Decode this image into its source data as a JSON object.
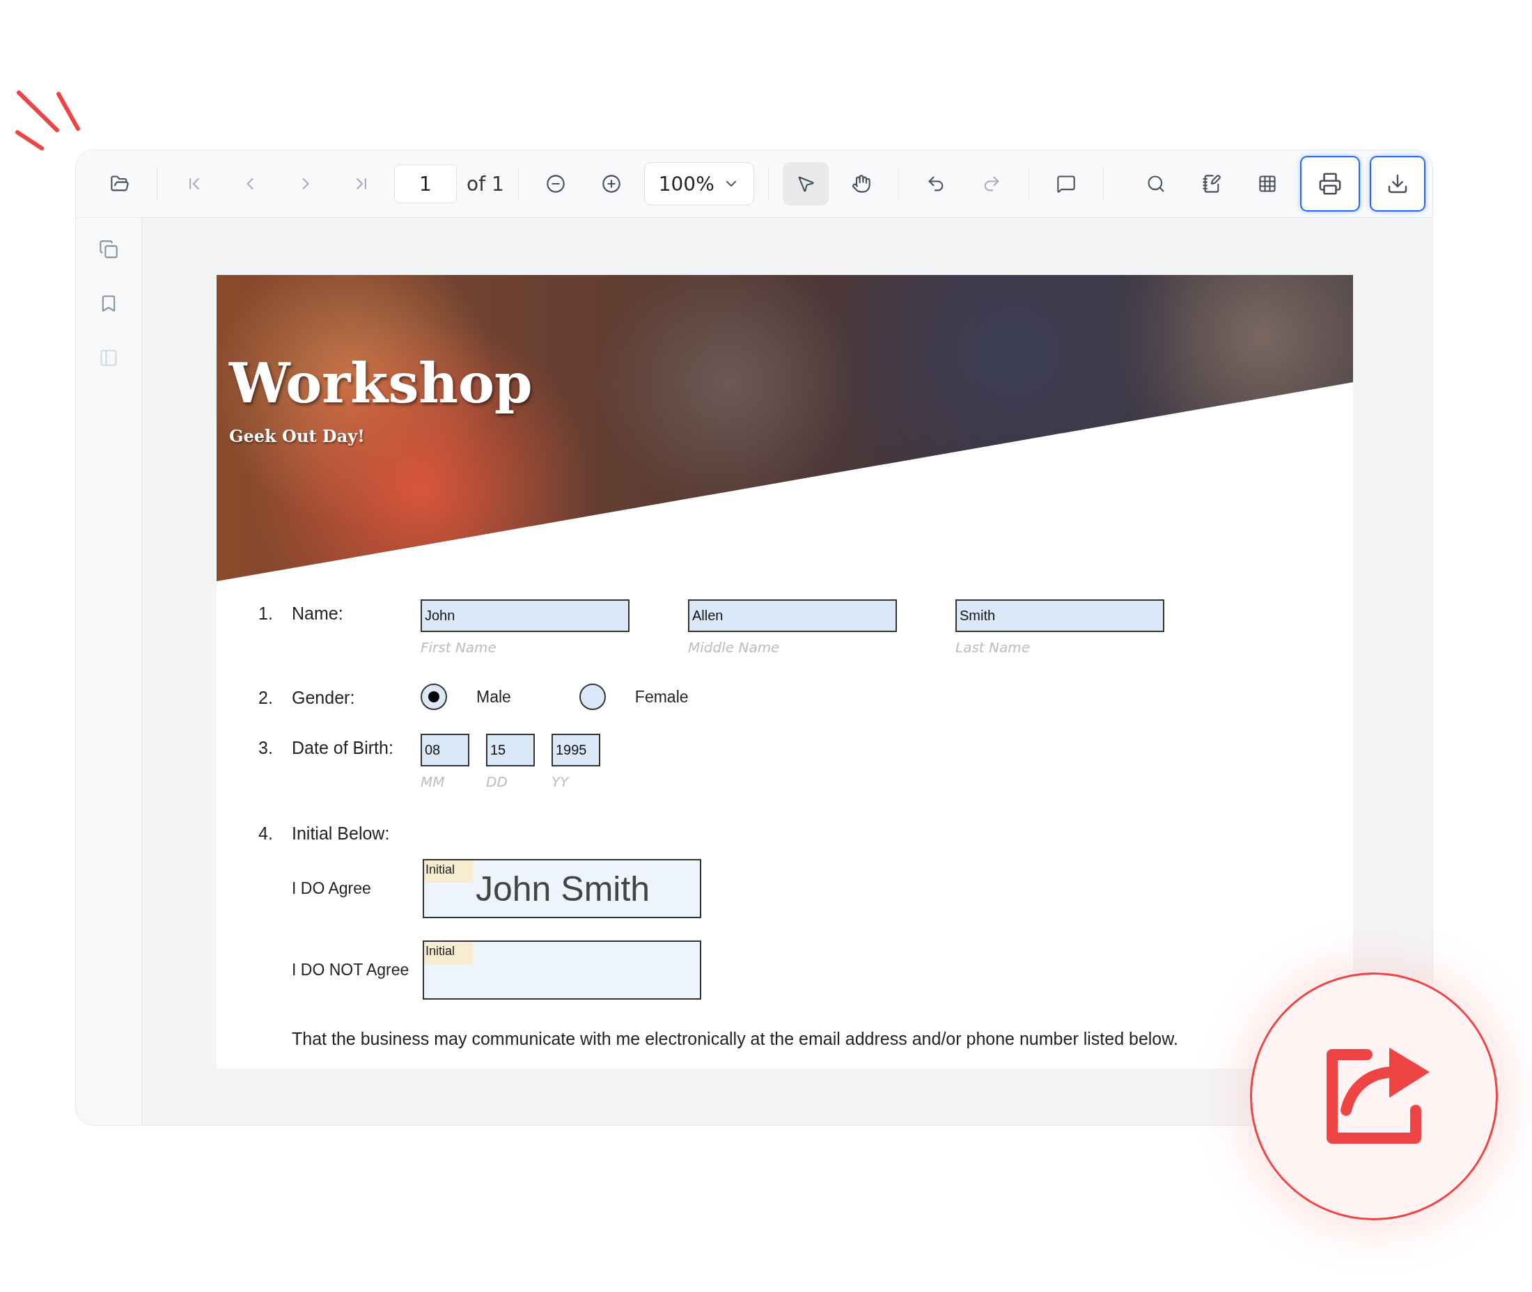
{
  "toolbar": {
    "navigation": [
      {
        "disabled": true
      },
      {
        "disabled": true
      },
      {
        "disabled": true
      },
      {
        "disabled": true
      }
    ],
    "page_input": "1",
    "page_total": "of 1",
    "zoom": "100%",
    "tools": [
      {
        "selected": true
      },
      {
        "selected": false
      }
    ],
    "history": [
      {
        "disabled": false
      },
      {
        "disabled": true
      }
    ]
  },
  "sidebar": {
    "items": [
      {
        "disabled": false
      },
      {
        "disabled": false
      },
      {
        "disabled": true
      }
    ]
  },
  "document": {
    "banner": {
      "title": "Workshop",
      "subtitle": "Geek Out Day!"
    },
    "questions": [
      {
        "kind": "text_fields",
        "number": "1.",
        "label": "Name:",
        "fields": [
          {
            "value": "John",
            "caption": "First Name"
          },
          {
            "value": "Allen",
            "caption": "Middle Name"
          },
          {
            "value": "Smith",
            "caption": "Last Name"
          }
        ]
      },
      {
        "kind": "radio",
        "number": "2.",
        "label": "Gender:",
        "options": [
          {
            "label": "Male",
            "selected": true
          },
          {
            "label": "Female",
            "selected": false
          }
        ]
      },
      {
        "kind": "date",
        "number": "3.",
        "label": "Date of Birth:",
        "fields": [
          {
            "value": "08",
            "caption": "MM"
          },
          {
            "value": "15",
            "caption": "DD"
          },
          {
            "value": "1995",
            "caption": "YY"
          }
        ]
      },
      {
        "kind": "initials",
        "number": "4.",
        "label": "Initial Below:",
        "rows": [
          {
            "label": "I DO Agree",
            "tag": "Initial",
            "value": "John Smith"
          },
          {
            "label": "I DO NOT Agree",
            "tag": "Initial"
          }
        ]
      }
    ],
    "footer": "That the business may communicate with me electronically at the email address and/or phone number listed below."
  }
}
